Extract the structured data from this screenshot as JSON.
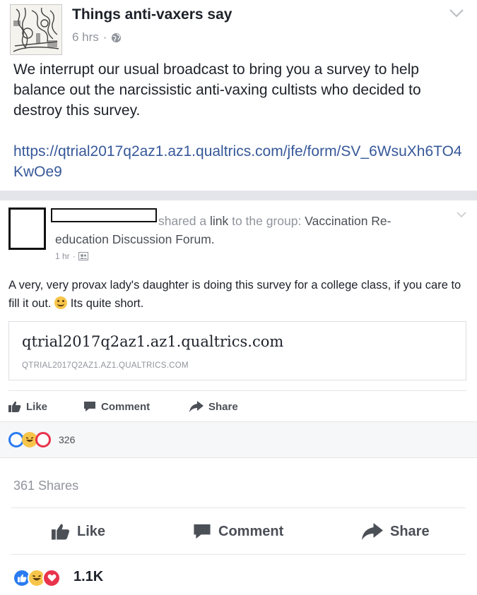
{
  "outer_post": {
    "page_name": "Things anti-vaxers say",
    "time": "6 hrs",
    "dot": "·",
    "body": "We interrupt our usual broadcast to bring you a survey to help balance out the narcissistic anti-vaxing cultists who decided to destroy this survey.",
    "link": "https://qtrial2017q2az1.az1.qualtrics.com/jfe/form/SV_6WsuXh6TO4KwOe9",
    "shares": "361 Shares",
    "actions": {
      "like": "Like",
      "comment": "Comment",
      "share": "Share"
    },
    "reaction_count": "1.1K"
  },
  "shared_post": {
    "shared_text": "shared a link to the group:",
    "link_word": "link",
    "group_name": "Vaccination Re-education Discussion Forum.",
    "time": "1 hr",
    "dot": "·",
    "body_before_emoji": "A very, very provax lady's daughter is doing this survey for a college class, if you care to fill it out.",
    "body_after_emoji": "Its quite short.",
    "link_card": {
      "title": "qtrial2017q2az1.az1.qualtrics.com",
      "domain": "QTRIAL2017Q2AZ1.AZ1.QUALTRICS.COM"
    },
    "actions": {
      "like": "Like",
      "comment": "Comment",
      "share": "Share"
    },
    "reaction_count": "326"
  },
  "colors": {
    "link_blue": "#365899",
    "meta_gray": "#90949c",
    "like_blue": "#2a7bf0",
    "love_red": "#e8344c",
    "haha_yellow": "#f7c54a"
  },
  "icons": [
    "globe-icon",
    "chevron-down-icon",
    "like-thumb-icon",
    "comment-bubble-icon",
    "share-arrow-icon",
    "group-icon"
  ]
}
